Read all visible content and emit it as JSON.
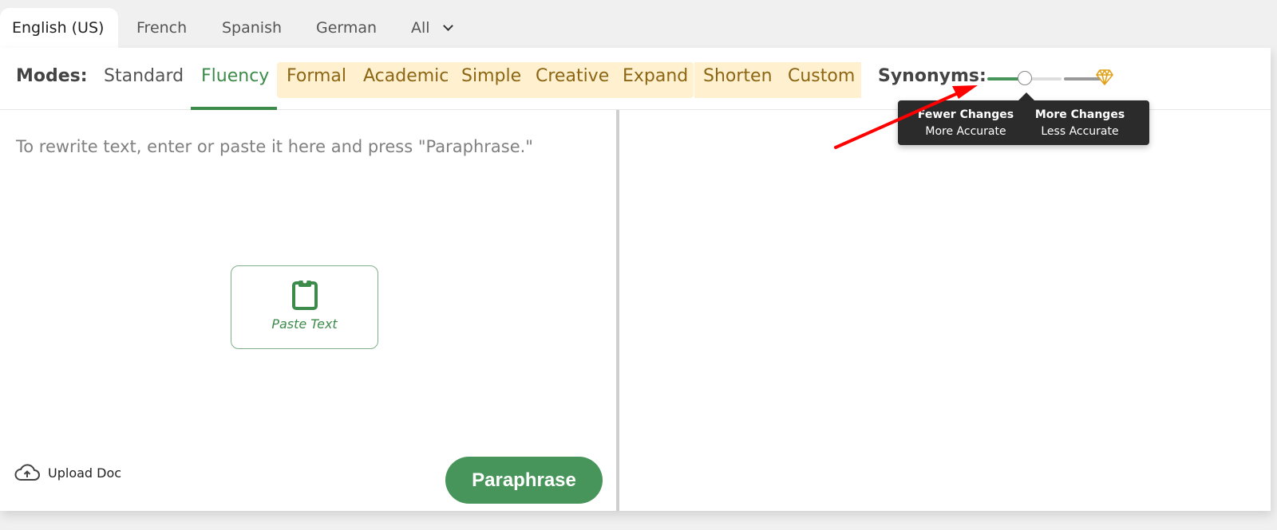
{
  "language_tabs": [
    {
      "label": "English (US)",
      "active": true
    },
    {
      "label": "French",
      "active": false
    },
    {
      "label": "Spanish",
      "active": false
    },
    {
      "label": "German",
      "active": false
    },
    {
      "label": "All",
      "active": false,
      "dropdown": true
    }
  ],
  "modes": {
    "label": "Modes:",
    "items": [
      {
        "label": "Standard",
        "active": false,
        "premium": false
      },
      {
        "label": "Fluency",
        "active": true,
        "premium": false
      },
      {
        "label": "Formal",
        "active": false,
        "premium": true
      },
      {
        "label": "Academic",
        "active": false,
        "premium": true
      },
      {
        "label": "Simple",
        "active": false,
        "premium": true
      },
      {
        "label": "Creative",
        "active": false,
        "premium": true
      },
      {
        "label": "Expand",
        "active": false,
        "premium": true
      },
      {
        "label": "Shorten",
        "active": false,
        "premium": true
      },
      {
        "label": "Custom",
        "active": false,
        "premium": true
      }
    ]
  },
  "synonyms": {
    "label": "Synonyms:",
    "slider_value_fraction": 0.3,
    "premium_icon": "diamond-icon",
    "tooltip": {
      "left_title": "Fewer Changes",
      "left_subtitle": "More Accurate",
      "right_title": "More Changes",
      "right_subtitle": "Less Accurate"
    }
  },
  "input": {
    "placeholder": "To rewrite text, enter or paste it here and press \"Paraphrase.\"",
    "paste_button_label": "Paste Text",
    "paste_icon": "clipboard-icon"
  },
  "footer": {
    "upload_label": "Upload Doc",
    "upload_icon": "cloud-upload-icon",
    "paraphrase_label": "Paraphrase"
  },
  "colors": {
    "accent_green": "#3d8b4a",
    "button_green": "#47955a",
    "premium_bg": "#fff1cf",
    "premium_text": "#8c6614",
    "tooltip_bg": "#2b2b2b",
    "annotation_red": "#ff0000",
    "diamond_gold": "#e0a21a"
  },
  "annotation": {
    "type": "red-arrow",
    "points_to": "synonyms-label"
  }
}
